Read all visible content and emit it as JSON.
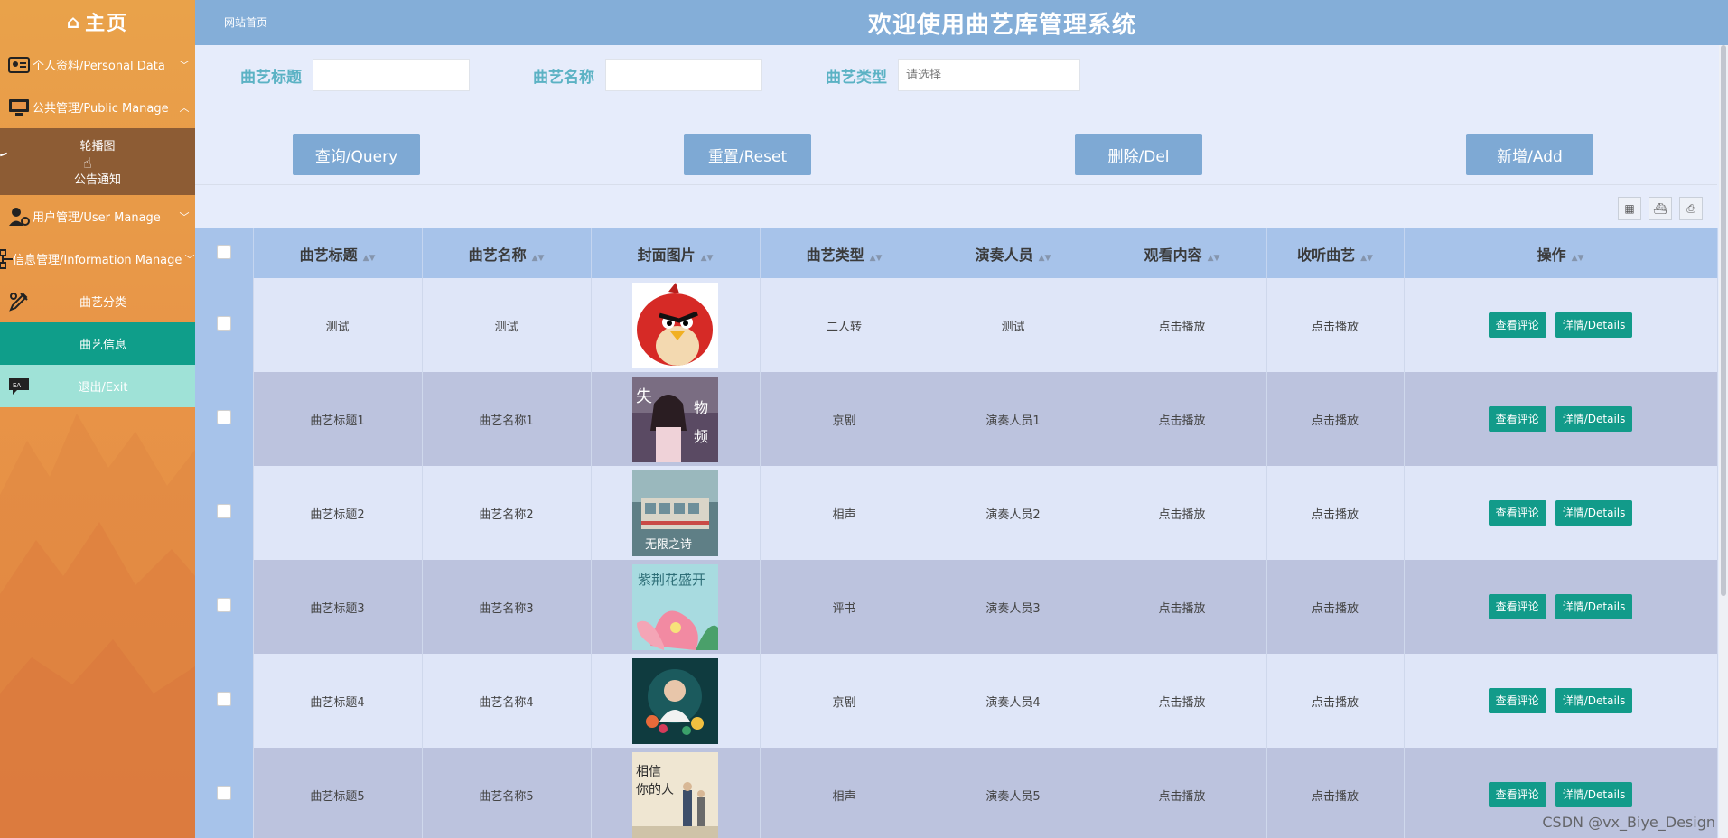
{
  "sidebar": {
    "home_label": "主页",
    "items": [
      {
        "label": "个人资料/Personal Data"
      },
      {
        "label": "公共管理/Public Manage"
      },
      {
        "label": "用户管理/User Manage"
      },
      {
        "label": "信息管理/Information Manage"
      },
      {
        "label": "曲艺分类"
      },
      {
        "label": "曲艺信息"
      },
      {
        "label": "退出/Exit"
      }
    ],
    "subitems": [
      {
        "label": "轮播图"
      },
      {
        "label": "公告通知"
      }
    ]
  },
  "header": {
    "crumb": "网站首页",
    "title": "欢迎使用曲艺库管理系统"
  },
  "search": {
    "title_label": "曲艺标题",
    "name_label": "曲艺名称",
    "type_label": "曲艺类型",
    "type_placeholder": "请选择"
  },
  "buttons": {
    "query": "查询/Query",
    "reset": "重置/Reset",
    "delete": "删除/Del",
    "add": "新增/Add"
  },
  "table": {
    "columns": [
      "曲艺标题",
      "曲艺名称",
      "封面图片",
      "曲艺类型",
      "演奏人员",
      "观看内容",
      "收听曲艺",
      "操作"
    ],
    "rows": [
      {
        "title": "测试",
        "name": "测试",
        "type": "二人转",
        "performer": "测试",
        "watch": "点击播放",
        "listen": "点击播放"
      },
      {
        "title": "曲艺标题1",
        "name": "曲艺名称1",
        "type": "京剧",
        "performer": "演奏人员1",
        "watch": "点击播放",
        "listen": "点击播放"
      },
      {
        "title": "曲艺标题2",
        "name": "曲艺名称2",
        "type": "相声",
        "performer": "演奏人员2",
        "watch": "点击播放",
        "listen": "点击播放"
      },
      {
        "title": "曲艺标题3",
        "name": "曲艺名称3",
        "type": "评书",
        "performer": "演奏人员3",
        "watch": "点击播放",
        "listen": "点击播放"
      },
      {
        "title": "曲艺标题4",
        "name": "曲艺名称4",
        "type": "京剧",
        "performer": "演奏人员4",
        "watch": "点击播放",
        "listen": "点击播放"
      },
      {
        "title": "曲艺标题5",
        "name": "曲艺名称5",
        "type": "相声",
        "performer": "演奏人员5",
        "watch": "点击播放",
        "listen": "点击播放"
      }
    ],
    "op_view_comment": "查看评论",
    "op_details": "详情/Details"
  },
  "watermark": "CSDN @vx_Biye_Design",
  "colors": {
    "sidebar": "#e89447",
    "header": "#84aed8",
    "button": "#7ea9d4",
    "op_button": "#129b8a",
    "active_menu": "#0f9e8a"
  }
}
